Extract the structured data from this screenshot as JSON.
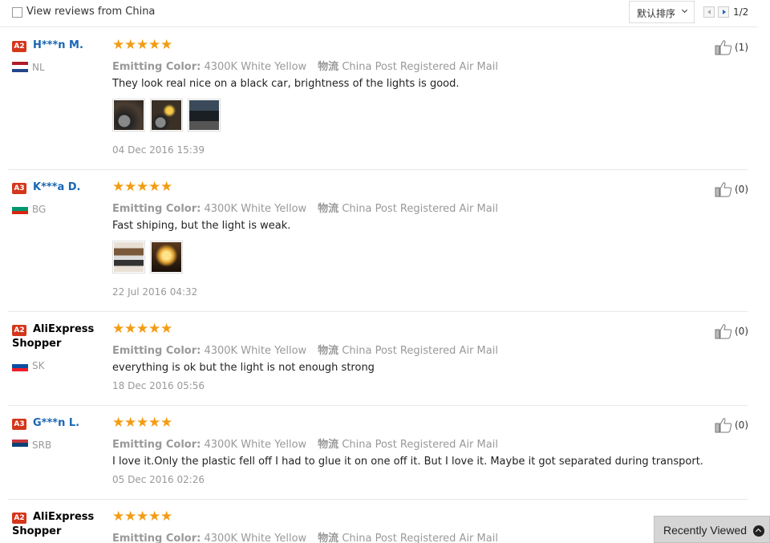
{
  "filter": {
    "china_label": "View reviews from China",
    "checked": false
  },
  "sort": {
    "label": "默认排序"
  },
  "pagination": {
    "text": "1/2"
  },
  "meta_labels": {
    "color_label": "Emitting Color:",
    "shipping_label": "物流"
  },
  "reviews": [
    {
      "badge": "A2",
      "name": "H***n M.",
      "country": "NL",
      "stars": 5,
      "color": "4300K White Yellow",
      "shipping": "China Post Registered Air Mail",
      "text": "They look real nice on a black car, brightness of the lights is good.",
      "date": "04 Dec 2016 15:39",
      "likes": "(1)",
      "photos": 3
    },
    {
      "badge": "A3",
      "name": "K***a D.",
      "country": "BG",
      "stars": 5,
      "color": "4300K White Yellow",
      "shipping": "China Post Registered Air Mail",
      "text": "Fast shiping, but the light is weak.",
      "date": "22 Jul 2016 04:32",
      "likes": "(0)",
      "photos": 2
    },
    {
      "badge": "A2",
      "name": "AliExpress Shopper",
      "country": "SK",
      "stars": 5,
      "color": "4300K White Yellow",
      "shipping": "China Post Registered Air Mail",
      "text": "everything is ok but the light is not enough strong",
      "date": "18 Dec 2016 05:56",
      "likes": "(0)",
      "photos": 0
    },
    {
      "badge": "A3",
      "name": "G***n L.",
      "country": "SRB",
      "stars": 5,
      "color": "4300K White Yellow",
      "shipping": "China Post Registered Air Mail",
      "text": "I love it.Only the plastic fell off I had to glue it on one off it. But I love it. Maybe it got separated during transport.",
      "date": "05 Dec 2016 02:26",
      "likes": "(0)",
      "photos": 0
    },
    {
      "badge": "A2",
      "name": "AliExpress Shopper",
      "country": "",
      "stars": 5,
      "color": "4300K White Yellow",
      "shipping": "China Post Registered Air Mail"
    }
  ],
  "recently_viewed": {
    "label": "Recently Viewed"
  },
  "colors": {
    "link": "#1a66b3",
    "badge": "#d4371c",
    "star": "#f39c12"
  },
  "icons": {
    "like": "thumbs-up-icon",
    "star": "star-icon",
    "flag": "country-flag-icon",
    "up": "chevron-up-icon"
  }
}
